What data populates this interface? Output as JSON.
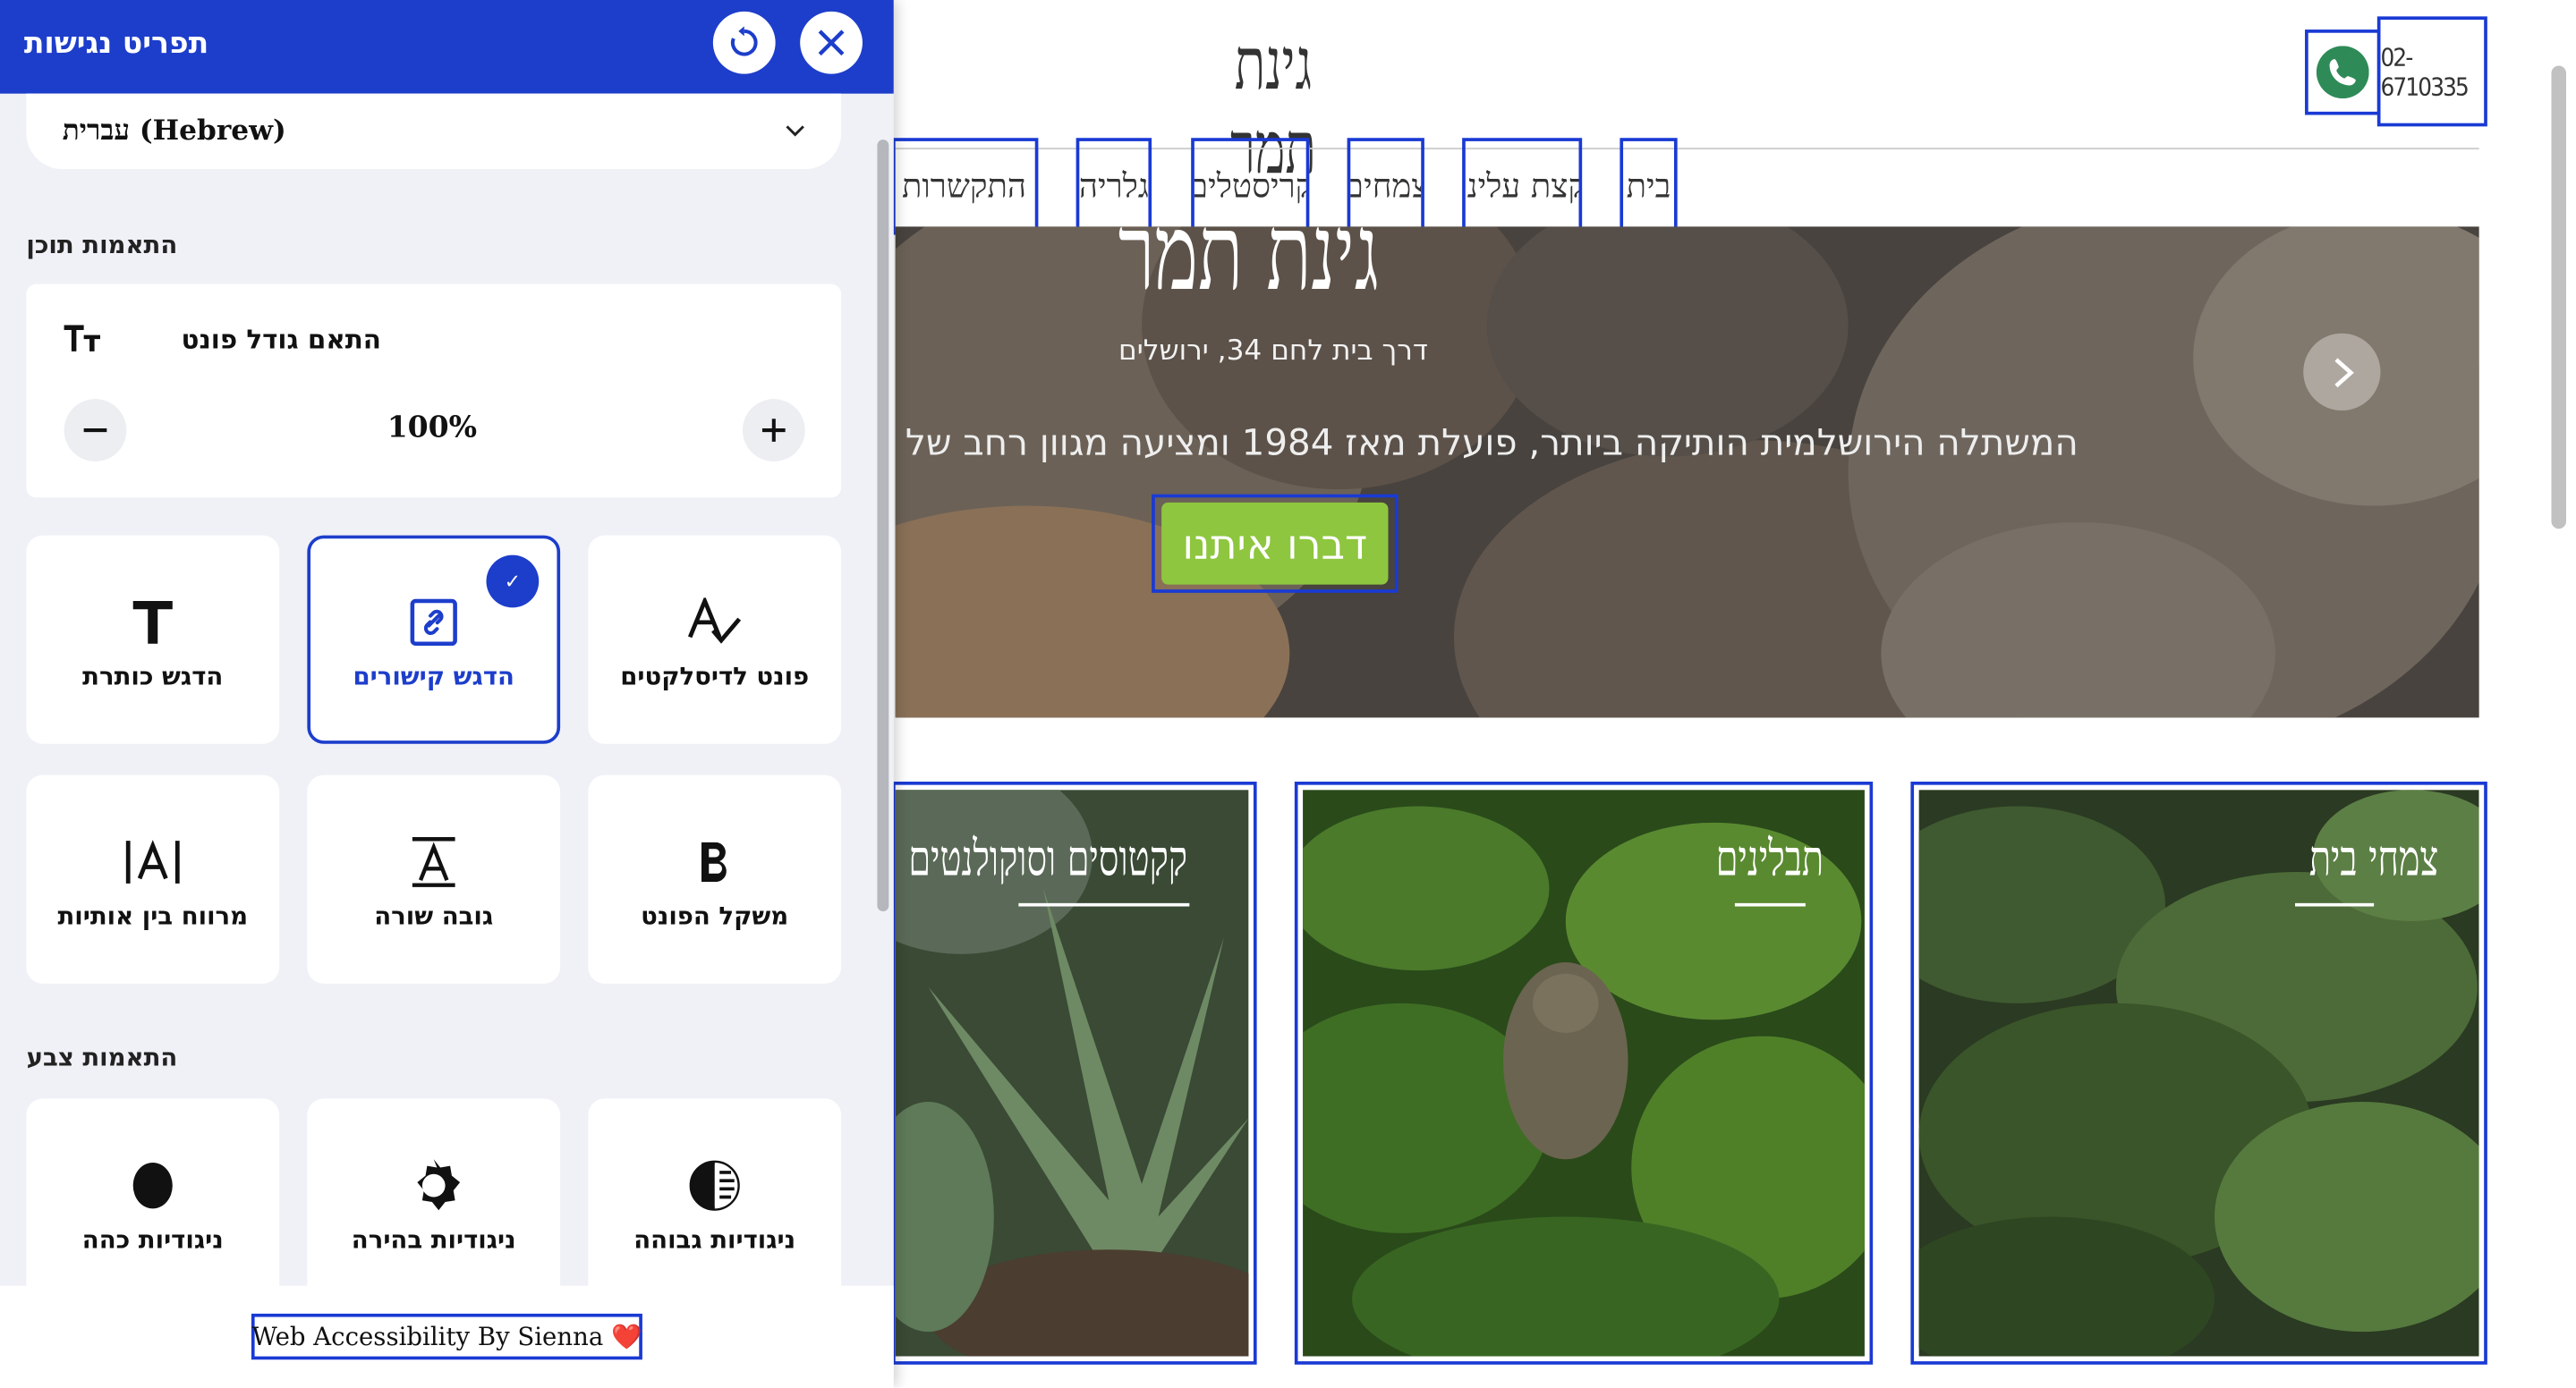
{
  "site": {
    "logo_text": "גינת תמר",
    "phone_number": "02-6710335",
    "nav": [
      {
        "label": "בית"
      },
      {
        "label": "קצת עלינו"
      },
      {
        "label": "צמחים"
      },
      {
        "label": "קריסטלים"
      },
      {
        "label": "גלריה"
      },
      {
        "label": "דרכי התקשרות"
      }
    ],
    "hero": {
      "title": "גינת תמר",
      "address": "דרך בית לחם 34, ירושלים",
      "description": "המשתלה הירושלמית הותיקה ביותר, פועלת מאז 1984 ומציעה מגוון רחב של צמחים א",
      "cta_label": "דברו איתנו"
    },
    "categories": [
      {
        "title": "צמחי בית"
      },
      {
        "title": "תבלינים"
      },
      {
        "title": "קקטוסים וסוקולנטים"
      }
    ]
  },
  "panel": {
    "title": "תפריט נגישות",
    "language": "עברית (Hebrew)",
    "content_section": "התאמות תוכן",
    "font_size_label": "התאם גודל פונט",
    "font_size_value": "100%",
    "content_tiles": [
      {
        "label": "הדגש כותרת",
        "icon": "heading-T-icon"
      },
      {
        "label": "הדגש קישורים",
        "icon": "link-icon",
        "active": true
      },
      {
        "label": "פונט לדיסלקטים",
        "icon": "dyslexia-font-icon"
      },
      {
        "label": "מרווח בין אותיות",
        "icon": "letter-spacing-icon"
      },
      {
        "label": "גובה שורה",
        "icon": "line-height-icon"
      },
      {
        "label": "משקל הפונט",
        "icon": "bold-B-icon"
      }
    ],
    "color_section": "התאמות צבע",
    "color_tiles": [
      {
        "label": "ניגודיות כהה",
        "icon": "dark-contrast-icon"
      },
      {
        "label": "ניגודיות בהירה",
        "icon": "light-contrast-icon"
      },
      {
        "label": "ניגודיות גבוהה",
        "icon": "high-contrast-icon"
      }
    ],
    "credit": "Web Accessibility By Sienna ❤️"
  },
  "colors": {
    "panel_blue": "#1d3ecb",
    "cta_green": "#8ec63f",
    "highlight_outline": "#1a3ad4",
    "phone_green": "#2e8b57"
  }
}
